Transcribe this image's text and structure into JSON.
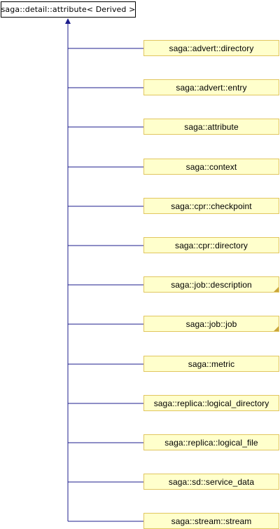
{
  "diagram": {
    "base_class": "saga::detail::attribute< Derived >",
    "derived_classes": [
      {
        "label": "saga::advert::directory",
        "folded": false
      },
      {
        "label": "saga::advert::entry",
        "folded": false
      },
      {
        "label": "saga::attribute",
        "folded": false
      },
      {
        "label": "saga::context",
        "folded": false
      },
      {
        "label": "saga::cpr::checkpoint",
        "folded": false
      },
      {
        "label": "saga::cpr::directory",
        "folded": false
      },
      {
        "label": "saga::job::description",
        "folded": true
      },
      {
        "label": "saga::job::job",
        "folded": true
      },
      {
        "label": "saga::metric",
        "folded": false
      },
      {
        "label": "saga::replica::logical_directory",
        "folded": false
      },
      {
        "label": "saga::replica::logical_file",
        "folded": false
      },
      {
        "label": "saga::sd::service_data",
        "folded": false
      },
      {
        "label": "saga::stream::stream",
        "folded": false
      }
    ],
    "colors": {
      "edge": "#1c1c8c",
      "child_fill": "#ffffcc",
      "child_border": "#e1c65f",
      "base_fill": "#ffffff",
      "base_border": "#000000"
    }
  }
}
